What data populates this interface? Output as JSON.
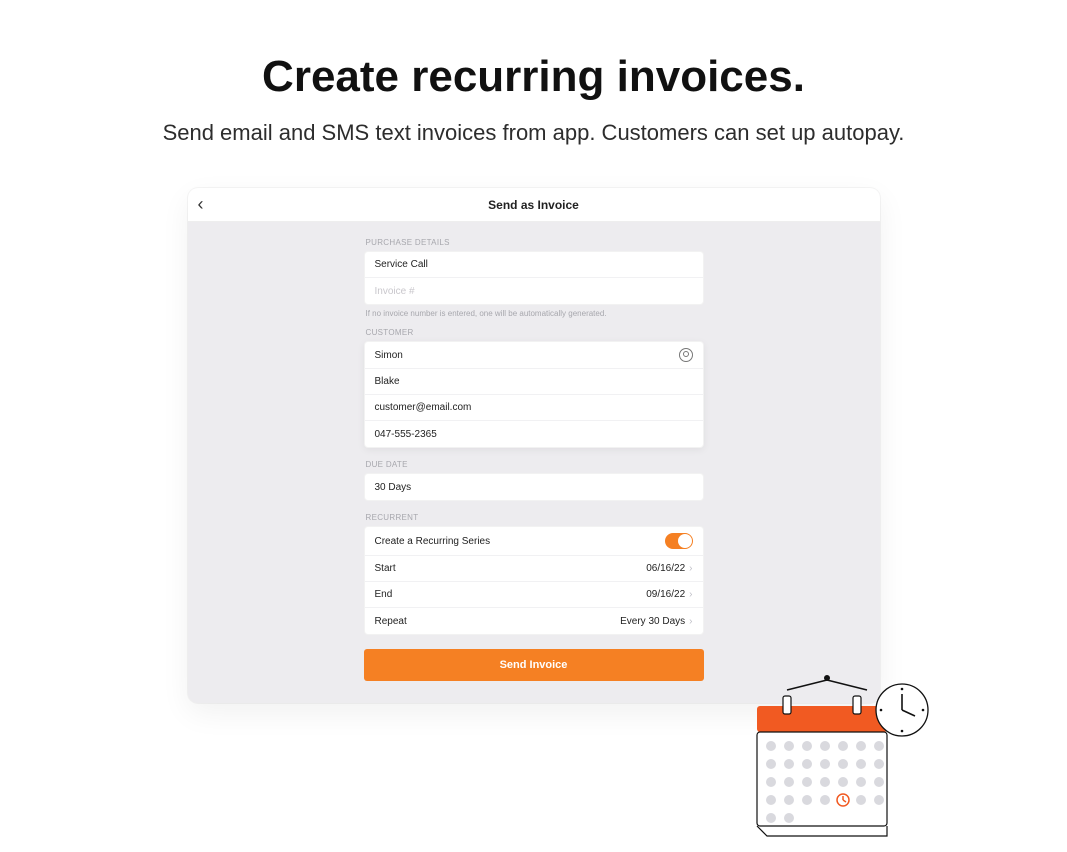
{
  "hero": {
    "title": "Create recurring invoices.",
    "subtitle": "Send email and SMS text invoices from app. Customers can set up autopay."
  },
  "topbar": {
    "title": "Send as Invoice"
  },
  "purchase": {
    "section": "PURCHASE DETAILS",
    "service_call": "Service Call",
    "invoice_placeholder": "Invoice #",
    "helper": "If no invoice number is entered, one will be automatically generated."
  },
  "customer": {
    "section": "CUSTOMER",
    "first": "Simon",
    "last": "Blake",
    "email": "customer@email.com",
    "phone": "047-555-2365"
  },
  "due": {
    "section": "DUE DATE",
    "value": "30 Days"
  },
  "recurrent": {
    "section": "RECURRENT",
    "create_label": "Create a Recurring Series",
    "start_label": "Start",
    "start_value": "06/16/22",
    "end_label": "End",
    "end_value": "09/16/22",
    "repeat_label": "Repeat",
    "repeat_value": "Every 30 Days"
  },
  "cta": {
    "send": "Send Invoice"
  }
}
